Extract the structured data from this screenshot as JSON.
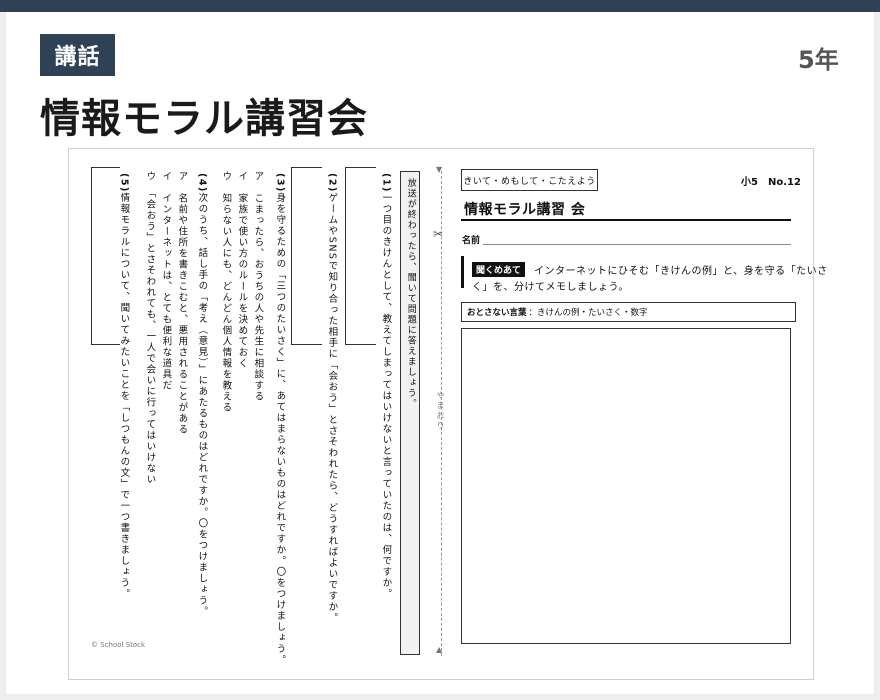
{
  "header": {
    "badge": "講話",
    "grade": "5年",
    "title": "情報モラル講習会"
  },
  "worksheet": {
    "strip_text": "放送が終わったら、聞いて問題に答えましょう。",
    "fold_label": "やまおり",
    "copyright": "© School Stock",
    "questions": [
      {
        "label": "(1)",
        "text": "一つ目のきけんとして、教えてしまってはいけないと言っていたのは、何ですか。"
      },
      {
        "label": "(2)",
        "text": "ゲームやSNSで知り合った相手に「会おう」とさそわれたら、どうすればよいですか。"
      },
      {
        "label": "(3)",
        "text": "身を守るための「三つのたいさく」に、あてはまらないものはどれですか。〇をつけましょう。",
        "options": [
          "ア　こまったら、おうちの人や先生に相談する",
          "イ　家族で使い方のルールを決めておく",
          "ウ　知らない人にも、どんどん個人情報を教える"
        ]
      },
      {
        "label": "(4)",
        "text": "次のうち、話し手の「考え（意見）」にあたるものはどれですか。〇をつけましょう。",
        "options": [
          "ア　名前や住所を書きこむと、悪用されることがある",
          "イ　インターネットは、とても便利な道具だ",
          "ウ　「会おう」とさそわれても、一人で会いに行ってはいけない"
        ]
      },
      {
        "label": "(5)",
        "text": "情報モラルについて、聞いてみたいことを「しつもんの文」で一つ書きましょう。"
      }
    ],
    "right": {
      "tag": "きいて・めもして・こたえよう",
      "unit": "小5　No.12",
      "title": "情報モラル講習 会",
      "name_label": "名前",
      "listen_badge": "聞くめあて",
      "listen_text_1": "インターネットにひそむ「きけんの例」と、身を守る「たいさ",
      "listen_text_2": "く」を、分けてメモしましょう。",
      "adult_label": "おとさない言葉",
      "adult_text": "：きけんの例・たいさく・数字"
    }
  }
}
